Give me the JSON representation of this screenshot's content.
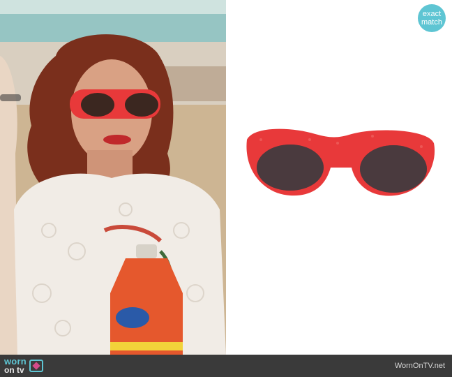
{
  "badge": {
    "line1": "exact",
    "line2": "match"
  },
  "footer": {
    "logo_worn": "worn",
    "logo_on": "on tv",
    "site": "WornOnTV.net"
  },
  "colors": {
    "accent": "#5ec5d3",
    "footer_bg": "#3a3a3a",
    "frame_red": "#e8393a"
  }
}
